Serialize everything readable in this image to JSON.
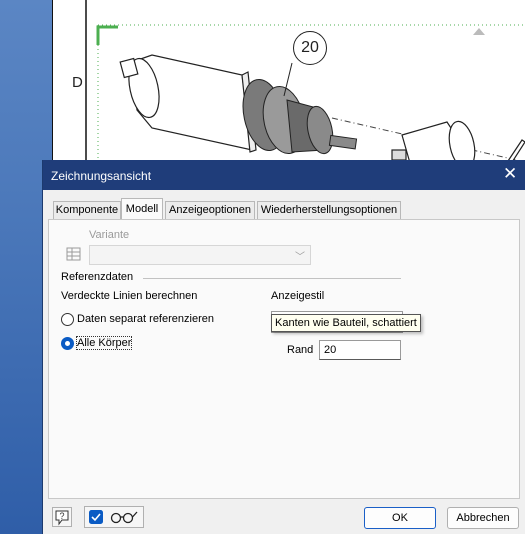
{
  "drawing": {
    "row_label": "D",
    "balloon_number": "20"
  },
  "dialog": {
    "title": "Zeichnungsansicht",
    "tabs": [
      {
        "label": "Komponente",
        "active": false
      },
      {
        "label": "Modell",
        "active": true
      },
      {
        "label": "Anzeigeoptionen",
        "active": false
      },
      {
        "label": "Wiederherstellungsoptionen",
        "active": false
      }
    ],
    "variante": {
      "label": "Variante",
      "value": ""
    },
    "referenzdaten": {
      "heading": "Referenzdaten",
      "hidden_lines_label": "Verdeckte Linien berechnen",
      "options": [
        {
          "label": "Daten separat referenzieren",
          "selected": false
        },
        {
          "label": "Alle Körper",
          "selected": true
        }
      ],
      "display_style_label": "Anzeigestil",
      "display_style_value": "Kanten wie Bauteil, schattiert",
      "margin_label": "Rand",
      "margin_value": "20"
    },
    "footer": {
      "help_icon": "help-icon",
      "checkbox_checked": true,
      "glasses_icon": "glasses-icon",
      "ok_label": "OK",
      "cancel_label": "Abbrechen"
    },
    "colors": {
      "titlebar": "#1f3d7a",
      "accent": "#0a5bc4"
    }
  }
}
